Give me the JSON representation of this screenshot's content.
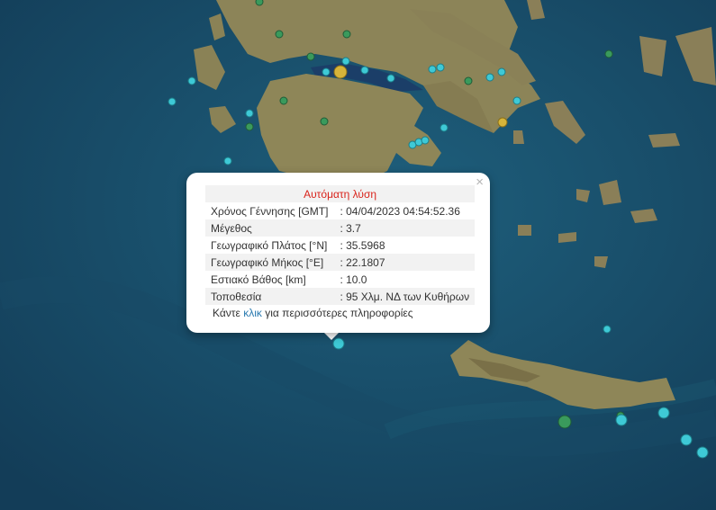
{
  "popup": {
    "title": "Αυτόματη λύση",
    "close_glyph": "×",
    "rows": [
      {
        "label": "Χρόνος Γέννησης [GMT]",
        "value": ": 04/04/2023 04:54:52.36"
      },
      {
        "label": "Μέγεθος",
        "value": ": 3.7"
      },
      {
        "label": "Γεωγραφικό Πλάτος [°N]",
        "value": ": 35.5968"
      },
      {
        "label": "Γεωγραφικό Μήκος [°E]",
        "value": ": 22.1807"
      },
      {
        "label": "Εστιακό Βάθος [km]",
        "value": ": 10.0"
      },
      {
        "label": "Τοποθεσία",
        "value": ": 95 Χλμ. ΝΔ των Κυθήρων"
      }
    ],
    "more_prefix": "Κάντε ",
    "more_link": "κλικ",
    "more_suffix": " για περισσότερες πληροφορίες"
  },
  "colors": {
    "sea_deep": "#16415f",
    "sea_shallow": "#1d5f7a",
    "land": "#8f8660",
    "marker_cyan": "#3ec9d6",
    "marker_green": "#3a9a5c",
    "marker_yellow": "#d6b43a",
    "title_red": "#d9241c",
    "link_blue": "#2a7ab0"
  }
}
